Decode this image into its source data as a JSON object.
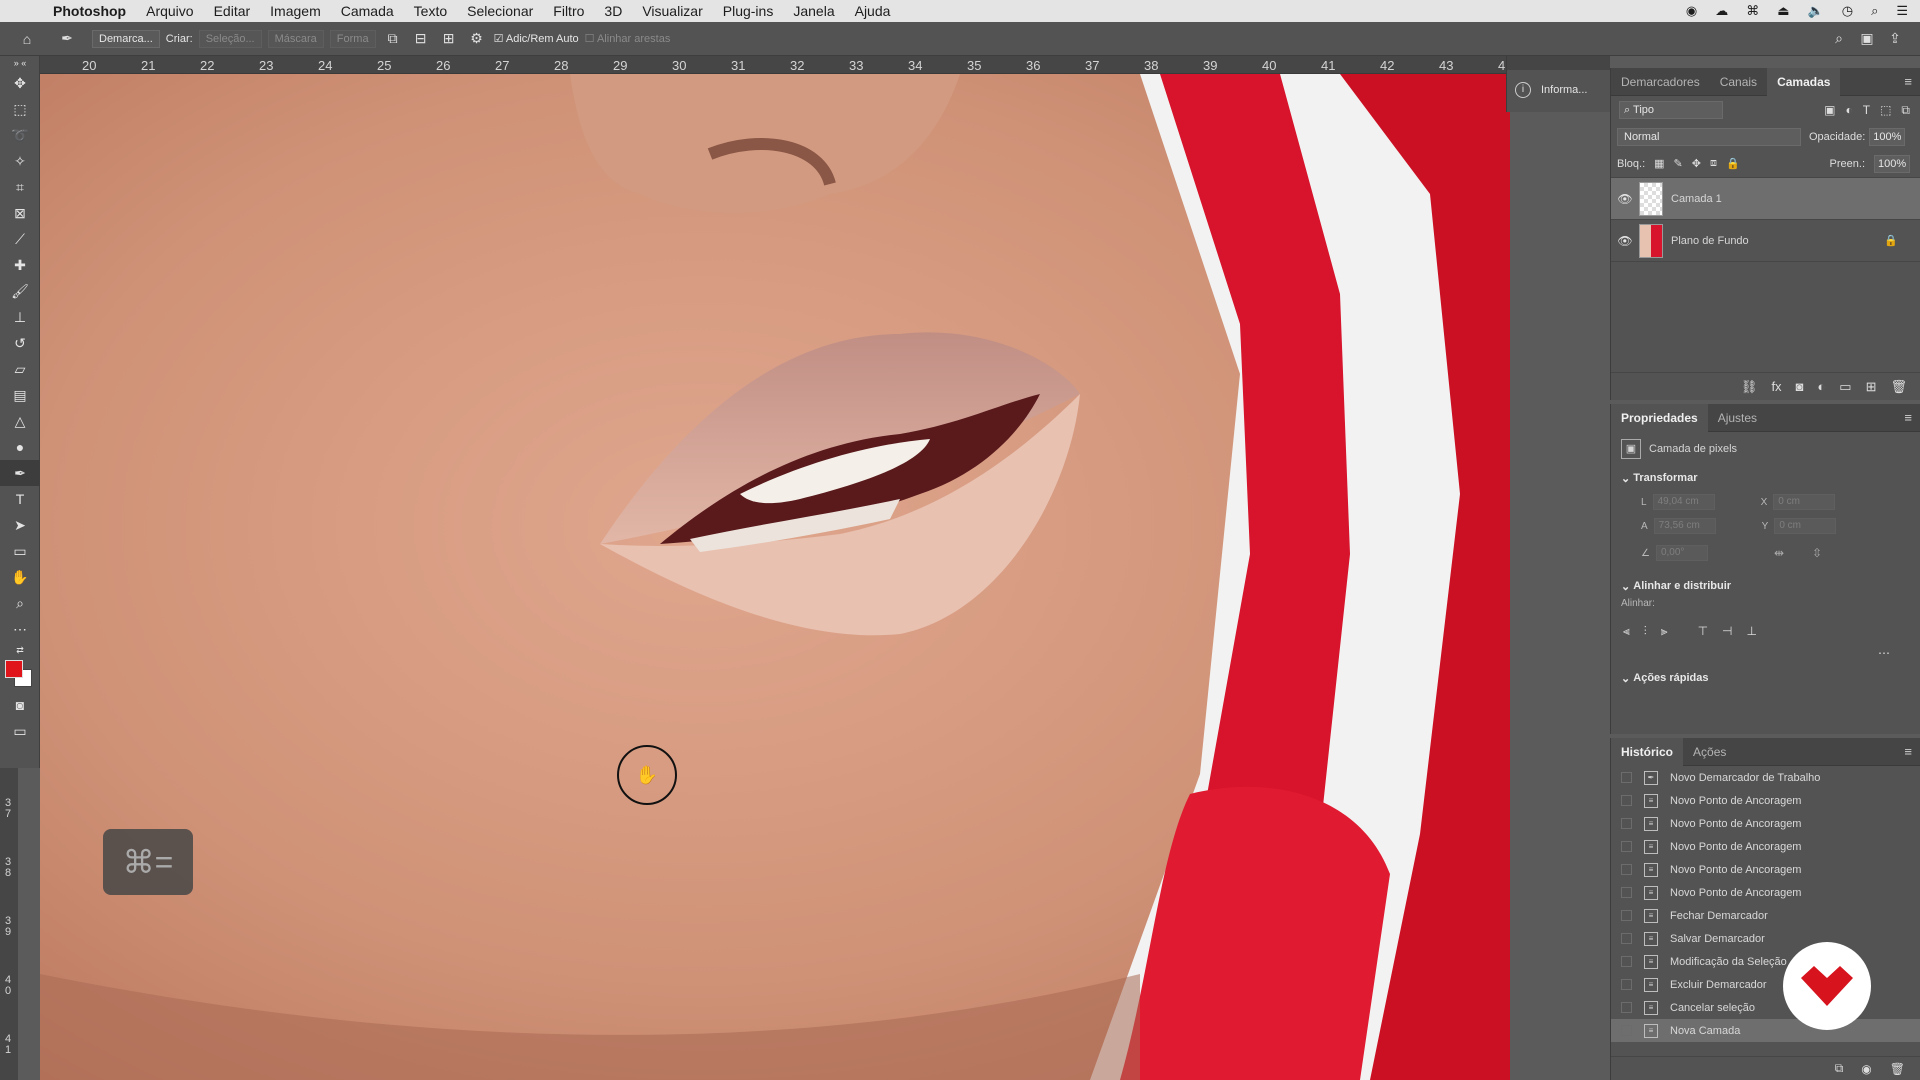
{
  "menubar": {
    "app": "Photoshop",
    "items": [
      "Arquivo",
      "Editar",
      "Imagem",
      "Camada",
      "Texto",
      "Selecionar",
      "Filtro",
      "3D",
      "Visualizar",
      "Plug-ins",
      "Janela",
      "Ajuda"
    ]
  },
  "options": {
    "preset": "Demarca...",
    "criar_label": "Criar:",
    "selecao": "Seleção...",
    "mascara": "Máscara",
    "forma": "Forma",
    "auto_add": "Adic/Rem Auto",
    "align_edges": "Alinhar arestas"
  },
  "ruler": {
    "h_ticks": [
      "20",
      "21",
      "22",
      "23",
      "24",
      "25",
      "26",
      "27",
      "28",
      "29",
      "30",
      "31",
      "32",
      "33",
      "34",
      "35",
      "36",
      "37",
      "38",
      "39",
      "40",
      "41",
      "42",
      "43",
      "4"
    ],
    "v_ticks": [
      "3\n7",
      "3\n8",
      "3\n9",
      "4\n0",
      "4\n1"
    ]
  },
  "info_panel": {
    "label": "Informa..."
  },
  "layers_panel": {
    "tabs": [
      "Demarcadores",
      "Canais",
      "Camadas"
    ],
    "active_tab": "Camadas",
    "filter": "Tipo",
    "blend_mode": "Normal",
    "opacity_label": "Opacidade:",
    "opacity": "100%",
    "lock_label": "Bloq.:",
    "fill_label": "Preen.:",
    "fill": "100%",
    "layers": [
      {
        "name": "Camada 1",
        "selected": true
      },
      {
        "name": "Plano de Fundo",
        "selected": false
      }
    ]
  },
  "properties_panel": {
    "tabs": [
      "Propriedades",
      "Ajustes"
    ],
    "pixel_layer": "Camada de pixels",
    "transform": "Transformar",
    "w": "49,04 cm",
    "h": "73,56 cm",
    "x": "0 cm",
    "y": "0 cm",
    "angle": "0,00°",
    "align_section": "Alinhar e distribuir",
    "align_label": "Alinhar:",
    "quick_actions": "Ações rápidas"
  },
  "history_panel": {
    "tabs": [
      "Histórico",
      "Ações"
    ],
    "items": [
      "Novo Demarcador de Trabalho",
      "Novo Ponto de Ancoragem",
      "Novo Ponto de Ancoragem",
      "Novo Ponto de Ancoragem",
      "Novo Ponto de Ancoragem",
      "Novo Ponto de Ancoragem",
      "Fechar Demarcador",
      "Salvar Demarcador",
      "Modificação da Seleção",
      "Excluir Demarcador",
      "Cancelar seleção",
      "Nova Camada"
    ]
  },
  "overlay": {
    "shortcut": "⌘="
  },
  "colors": {
    "foreground": "#e0141b",
    "background": "#ffffff",
    "watermark": "#d7141e"
  }
}
